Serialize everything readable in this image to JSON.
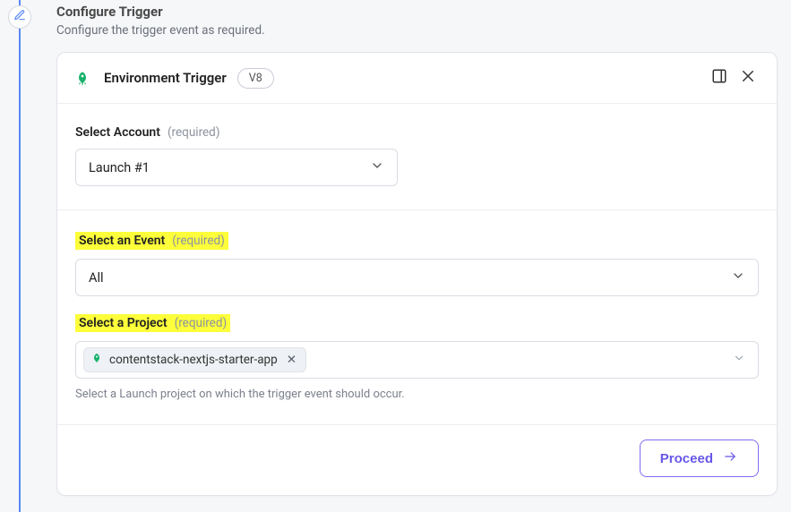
{
  "step": {
    "title": "Configure Trigger",
    "subtitle": "Configure the trigger event as required."
  },
  "card": {
    "title": "Environment Trigger",
    "version": "V8"
  },
  "fields": {
    "account": {
      "label": "Select Account",
      "required_hint": "(required)",
      "value": "Launch #1"
    },
    "event": {
      "label": "Select an Event",
      "required_hint": "(required)",
      "value": "All"
    },
    "project": {
      "label": "Select a Project",
      "required_hint": "(required)",
      "selected_tag": "contentstack-nextjs-starter-app",
      "helper": "Select a Launch project on which the trigger event should occur."
    }
  },
  "actions": {
    "proceed": "Proceed"
  }
}
